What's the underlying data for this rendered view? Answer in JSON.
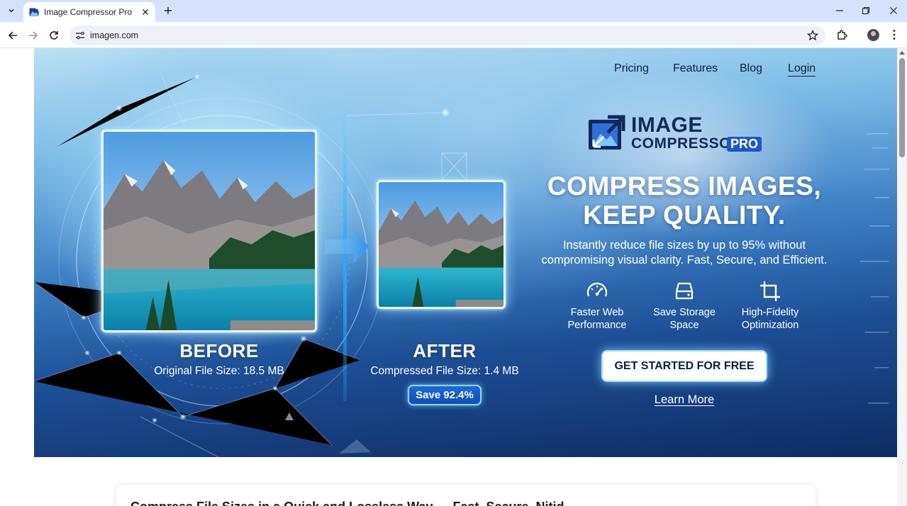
{
  "browser": {
    "tab_title": "Image Compressor Pro",
    "url": "imagen.com"
  },
  "nav": {
    "items": [
      "Pricing",
      "Features",
      "Blog",
      "Login"
    ]
  },
  "comparison": {
    "before": {
      "title": "BEFORE",
      "caption": "Original File Size: 18.5 MB"
    },
    "after": {
      "title": "AFTER",
      "caption": "Compressed File Size: 1.4 MB"
    },
    "save_badge": "Save 92.4%"
  },
  "logo": {
    "line1": "IMAGE",
    "line2": "COMPRESSOR",
    "badge": "PRO"
  },
  "hero": {
    "headline_1": "COMPRESS IMAGES,",
    "headline_2": "KEEP QUALITY.",
    "sub_1": "Instantly reduce file sizes by up to 95% without",
    "sub_2": "compromising visual clarity. Fast, Secure, and Efficient."
  },
  "features": [
    {
      "icon": "speedometer-icon",
      "line1": "Faster Web",
      "line2": "Performance"
    },
    {
      "icon": "hard-drive-icon",
      "line1": "Save Storage",
      "line2": "Space"
    },
    {
      "icon": "crop-icon",
      "line1": "High-Fidelity",
      "line2": "Optimization"
    }
  ],
  "cta": {
    "primary": "GET STARTED FOR FREE",
    "secondary": "Learn More"
  },
  "next_section": {
    "peek_text": "Compress File Sizes in a Quick and Lossless Way — Fast, Secure, Nitid"
  },
  "colors": {
    "accent": "#1e57c6",
    "hero_dark": "#0e2c63",
    "hero_light": "#b9e0f5",
    "text_dark": "#0f1d3a"
  }
}
